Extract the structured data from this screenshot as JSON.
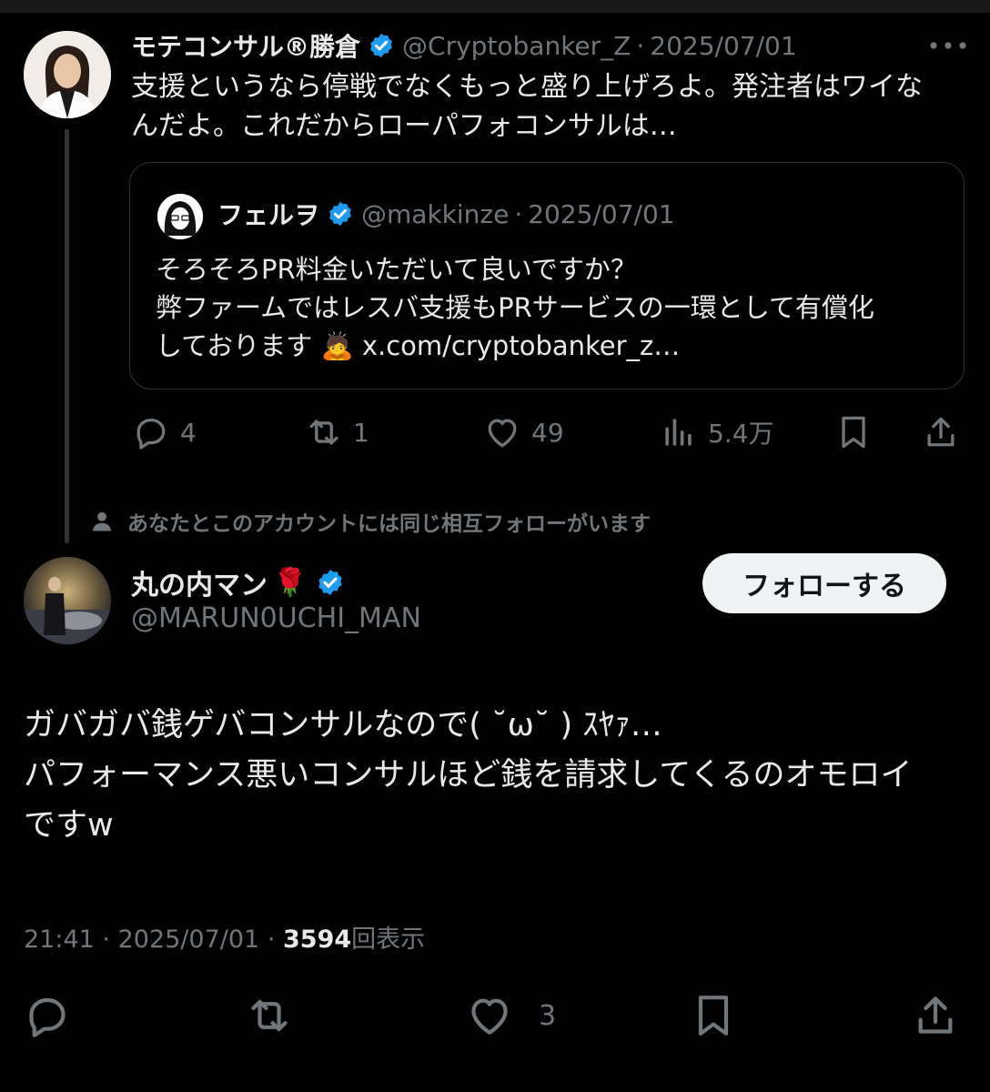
{
  "parent_tweet": {
    "display_name": "モテコンサル®勝倉",
    "handle": "@Cryptobanker_Z",
    "separator": "·",
    "date": "2025/07/01",
    "text_line1": "支援というなら停戦でなくもっと盛り上げろよ。発注者はワイな",
    "text_line2": "んだよ。これだからローパフォコンサルは…",
    "quote": {
      "display_name": "フェルヲ",
      "handle": "@makkinze",
      "separator": "·",
      "date": "2025/07/01",
      "line1": "そろそろPR料金いただいて良いですか？",
      "line2": "弊ファームではレスバ支援もPRサービスの一環として有償化",
      "line3_text": "しております",
      "line3_emoji": "🙇",
      "line3_link": "x.com/cryptobanker_z…"
    },
    "actions": {
      "replies": "4",
      "retweets": "1",
      "likes": "49",
      "views": "5.4万"
    }
  },
  "context_text": "あなたとこのアカウントには同じ相互フォローがいます",
  "main_tweet": {
    "display_name": "丸の内マン",
    "name_emoji": "🌹",
    "handle": "@MARUN0UCHI_MAN",
    "follow_label": "フォローする",
    "line1": "ガバガバ銭ゲバコンサルなので( ˘ω˘ ) ｽﾔｧ…",
    "line2": "パフォーマンス悪いコンサルほど銭を請求してくるのオモロイ",
    "line3": "ですw",
    "time": "21:41",
    "date": "2025/07/01",
    "separator": "·",
    "view_count": "3594",
    "view_label": "回表示",
    "likes": "3"
  },
  "colors": {
    "background": "#000000",
    "text": "#e7e9ea",
    "muted": "#71767b",
    "verified": "#1d9bf0",
    "border": "#2f3336"
  }
}
